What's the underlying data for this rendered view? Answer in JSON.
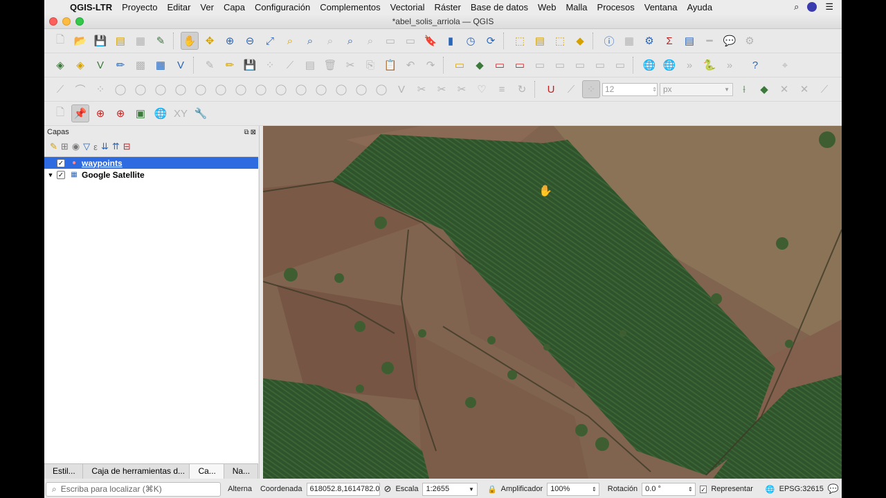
{
  "menubar": {
    "app_name": "QGIS-LTR",
    "items": [
      "Proyecto",
      "Editar",
      "Ver",
      "Capa",
      "Configuración",
      "Complementos",
      "Vectorial",
      "Ráster",
      "Base de datos",
      "Web",
      "Malla",
      "Procesos",
      "Ventana",
      "Ayuda"
    ]
  },
  "window": {
    "title": "*abel_solis_arriola — QGIS"
  },
  "toolbar3": {
    "size_value": "12",
    "unit_value": "px"
  },
  "layers_panel": {
    "title": "Capas",
    "layers": [
      {
        "name": "waypoints",
        "checked": true,
        "selected": true
      },
      {
        "name": "Google Satellite",
        "checked": true,
        "selected": false
      }
    ],
    "tabs": [
      "Estil...",
      "Caja de herramientas d...",
      "Ca...",
      "Na..."
    ]
  },
  "statusbar": {
    "locator_placeholder": "Escriba para localizar (⌘K)",
    "toggle_label": "Alterna",
    "coordinate_label": "Coordenada",
    "coordinate_value": "618052.8,1614782.0",
    "scale_label": "Escala",
    "scale_value": "1:2655",
    "magnifier_label": "Amplificador",
    "magnifier_value": "100%",
    "rotation_label": "Rotación",
    "rotation_value": "0.0 °",
    "render_label": "Representar",
    "crs_label": "EPSG:32615"
  },
  "colors": {
    "selection": "#2e6be0",
    "forest": "#2d4f2a",
    "field": "#80644f"
  }
}
